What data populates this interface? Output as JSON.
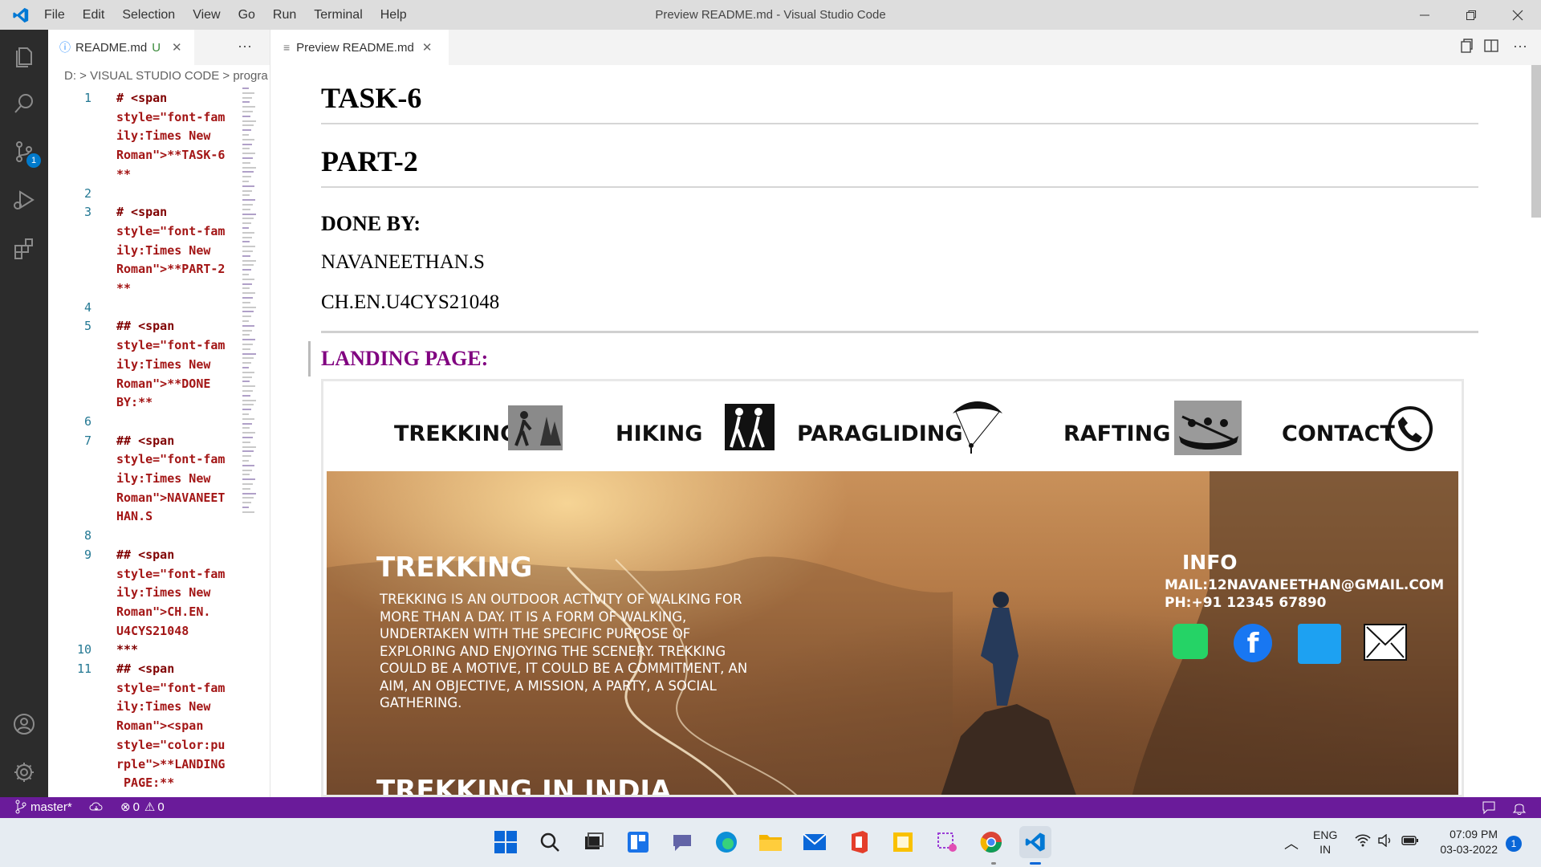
{
  "window": {
    "title": "Preview README.md - Visual Studio Code"
  },
  "menu": [
    "File",
    "Edit",
    "Selection",
    "View",
    "Go",
    "Run",
    "Terminal",
    "Help"
  ],
  "tabs": {
    "source_icon": "ⓘ",
    "source": "README.md",
    "source_status": "U",
    "more": "···",
    "preview_icon": "≡",
    "preview": "Preview README.md"
  },
  "breadcrumb": "D: > VISUAL STUDIO CODE > progra",
  "source_control_badge": "1",
  "code": [
    {
      "n": "1",
      "lines": [
        "# <span",
        "style=\"font-fam",
        "ily:Times New",
        "Roman\">**TASK-6",
        "**"
      ]
    },
    {
      "n": "2",
      "lines": [
        ""
      ]
    },
    {
      "n": "3",
      "lines": [
        "# <span",
        "style=\"font-fam",
        "ily:Times New",
        "Roman\">**PART-2",
        "**"
      ]
    },
    {
      "n": "4",
      "lines": [
        ""
      ]
    },
    {
      "n": "5",
      "lines": [
        "## <span",
        "style=\"font-fam",
        "ily:Times New",
        "Roman\">**DONE",
        "BY:**"
      ]
    },
    {
      "n": "6",
      "lines": [
        ""
      ]
    },
    {
      "n": "7",
      "lines": [
        "## <span",
        "style=\"font-fam",
        "ily:Times New",
        "Roman\">NAVANEET",
        "HAN.S"
      ]
    },
    {
      "n": "8",
      "lines": [
        ""
      ]
    },
    {
      "n": "9",
      "lines": [
        "## <span",
        "style=\"font-fam",
        "ily:Times New",
        "Roman\">CH.EN.",
        "U4CYS21048"
      ]
    },
    {
      "n": "10",
      "lines": [
        "***"
      ]
    },
    {
      "n": "11",
      "lines": [
        "## <span",
        "style=\"font-fam",
        "ily:Times New",
        "Roman\"><span",
        "style=\"color:pu",
        "rple\">**LANDING",
        " PAGE:**"
      ]
    }
  ],
  "preview": {
    "h1_task": "TASK-6",
    "h1_part": "PART-2",
    "h2_done": "DONE BY:",
    "name": "NAVANEETHAN.S",
    "roll": "CH.EN.U4CYS21048",
    "landing_heading": "LANDING PAGE:",
    "landing_color": "#800080"
  },
  "landing": {
    "nav": [
      "TREKKING",
      "HIKING",
      "PARAGLIDING",
      "RAFTING",
      "CONTACT"
    ],
    "hero_title": "TREKKING",
    "hero_text": [
      "TREKKING IS AN OUTDOOR ACTIVITY OF WALKING FOR",
      "MORE THAN A DAY. IT IS A FORM OF WALKING,",
      "UNDERTAKEN WITH THE SPECIFIC PURPOSE OF",
      "EXPLORING AND ENJOYING THE SCENERY. TREKKING",
      "COULD BE A MOTIVE, IT COULD BE A COMMITMENT, AN",
      "AIM, AN OBJECTIVE, A MISSION, A PARTY, A SOCIAL",
      "GATHERING."
    ],
    "info_title": "INFO",
    "info_mail": "MAIL:12NAVANEETHAN@GMAIL.COM",
    "info_phone": "PH:+91 12345 67890",
    "next_section": "TREKKING IN INDIA"
  },
  "statusbar": {
    "branch": "master*",
    "errors": "0",
    "warnings": "0"
  },
  "taskbar": {
    "lang1": "ENG",
    "lang2": "IN",
    "time": "07:09 PM",
    "date": "03-03-2022",
    "notif": "1"
  },
  "colors": {
    "statusbar": "#6a1b9a",
    "activitybar": "#2c2c2c",
    "accent": "#007acc"
  }
}
